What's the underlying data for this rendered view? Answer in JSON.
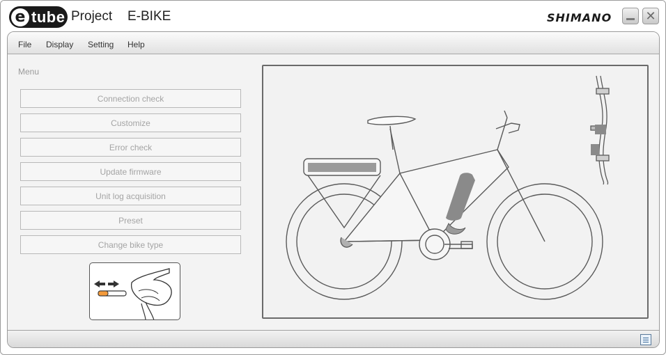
{
  "titlebar": {
    "logo_e": "e",
    "logo_text": "tube",
    "project": "Project",
    "bike": "E-BIKE",
    "brand": "SHIMANO",
    "close_glyph": "✕"
  },
  "menubar": {
    "file": "File",
    "display": "Display",
    "setting": "Setting",
    "help": "Help"
  },
  "sidebar": {
    "label": "Menu",
    "items": [
      {
        "label": "Connection check"
      },
      {
        "label": "Customize"
      },
      {
        "label": "Error check"
      },
      {
        "label": "Update firmware"
      },
      {
        "label": "Unit log acquisition"
      },
      {
        "label": "Preset"
      },
      {
        "label": "Change bike type"
      }
    ]
  },
  "icons": {
    "minimize": "minimize-icon",
    "close": "close-icon",
    "status": "log-icon",
    "hint": "shift-lever-illustration"
  },
  "colors": {
    "frame_bg": "#f3f3f3",
    "canvas_border": "#6a6a6a",
    "bike_stroke": "#5a5a5a",
    "battery": "#8a8a8a"
  }
}
